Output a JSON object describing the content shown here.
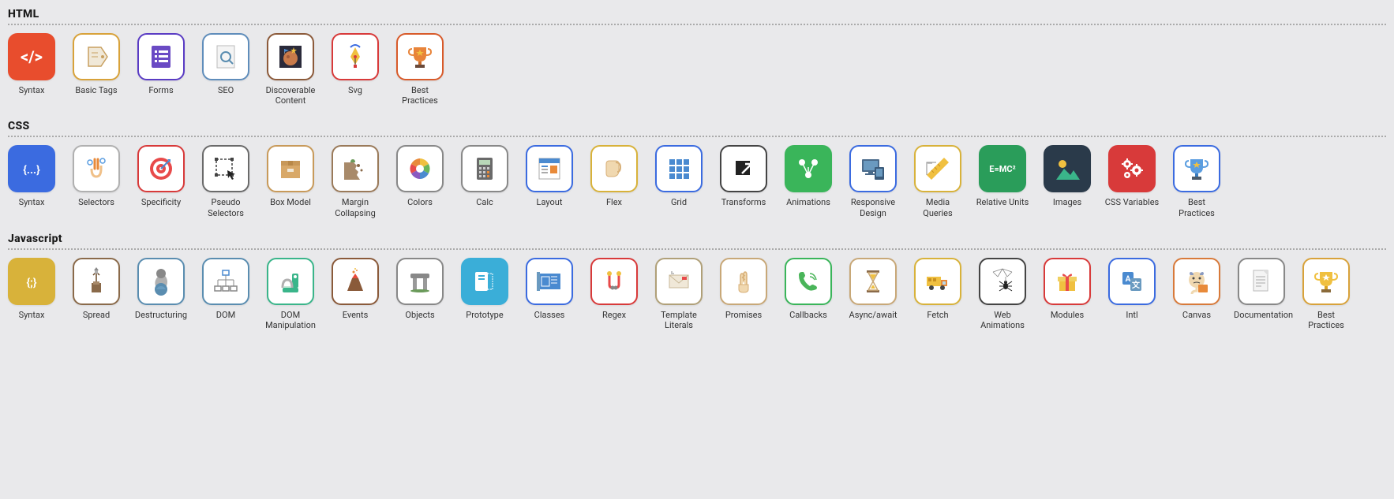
{
  "sections": [
    {
      "title": "HTML",
      "items": [
        {
          "label": "Syntax",
          "icon": "syntax-html",
          "bg": "#e84d2d",
          "border": "#e84d2d"
        },
        {
          "label": "Basic Tags",
          "icon": "tag",
          "bg": "#fff",
          "border": "#d8a23a"
        },
        {
          "label": "Forms",
          "icon": "form",
          "bg": "#fff",
          "border": "#5a3cc4"
        },
        {
          "label": "SEO",
          "icon": "seo",
          "bg": "#fff",
          "border": "#5f8dbb"
        },
        {
          "label": "Discoverable Content",
          "icon": "planet",
          "bg": "#fff",
          "border": "#8c5a3a"
        },
        {
          "label": "Svg",
          "icon": "pen",
          "bg": "#fff",
          "border": "#d83a3a"
        },
        {
          "label": "Best Practices",
          "icon": "trophy",
          "bg": "#fff",
          "border": "#d85a2a"
        }
      ]
    },
    {
      "title": "CSS",
      "items": [
        {
          "label": "Syntax",
          "icon": "syntax-css",
          "bg": "#3b6be0",
          "border": "#3b6be0"
        },
        {
          "label": "Selectors",
          "icon": "selectors",
          "bg": "#fff",
          "border": "#b0b0b0"
        },
        {
          "label": "Specificity",
          "icon": "target",
          "bg": "#fff",
          "border": "#d83a3a"
        },
        {
          "label": "Pseudo Selectors",
          "icon": "pseudo",
          "bg": "#fff",
          "border": "#6a6a6a"
        },
        {
          "label": "Box Model",
          "icon": "box",
          "bg": "#fff",
          "border": "#c89a5a"
        },
        {
          "label": "Margin Collapsing",
          "icon": "cliff",
          "bg": "#fff",
          "border": "#9a7a5a"
        },
        {
          "label": "Colors",
          "icon": "colors",
          "bg": "#fff",
          "border": "#888"
        },
        {
          "label": "Calc",
          "icon": "calc",
          "bg": "#fff",
          "border": "#888"
        },
        {
          "label": "Layout",
          "icon": "layout",
          "bg": "#fff",
          "border": "#3b6be0"
        },
        {
          "label": "Flex",
          "icon": "flex",
          "bg": "#fff",
          "border": "#d8b23a"
        },
        {
          "label": "Grid",
          "icon": "grid",
          "bg": "#fff",
          "border": "#3b6be0"
        },
        {
          "label": "Transforms",
          "icon": "transforms",
          "bg": "#fff",
          "border": "#444"
        },
        {
          "label": "Animations",
          "icon": "animations",
          "bg": "#3ab55a",
          "border": "#3ab55a"
        },
        {
          "label": "Responsive Design",
          "icon": "responsive",
          "bg": "#fff",
          "border": "#3b6be0"
        },
        {
          "label": "Media Queries",
          "icon": "ruler",
          "bg": "#fff",
          "border": "#d8b23a"
        },
        {
          "label": "Relative Units",
          "icon": "emc",
          "bg": "#2a9d5a",
          "border": "#2a9d5a"
        },
        {
          "label": "Images",
          "icon": "images",
          "bg": "#2a3a4a",
          "border": "#2a3a4a"
        },
        {
          "label": "CSS Variables",
          "icon": "gears",
          "bg": "#d83a3a",
          "border": "#d83a3a"
        },
        {
          "label": "Best Practices",
          "icon": "trophy-blue",
          "bg": "#fff",
          "border": "#3b6be0"
        }
      ]
    },
    {
      "title": "Javascript",
      "items": [
        {
          "label": "Syntax",
          "icon": "syntax-js",
          "bg": "#d8b23a",
          "border": "#d8b23a"
        },
        {
          "label": "Spread",
          "icon": "spread",
          "bg": "#fff",
          "border": "#8a6a4a"
        },
        {
          "label": "Destructuring",
          "icon": "destructuring",
          "bg": "#fff",
          "border": "#5a8db0"
        },
        {
          "label": "DOM",
          "icon": "dom",
          "bg": "#fff",
          "border": "#5a8db0"
        },
        {
          "label": "DOM Manipulation",
          "icon": "mixer",
          "bg": "#fff",
          "border": "#3ab58a"
        },
        {
          "label": "Events",
          "icon": "volcano",
          "bg": "#fff",
          "border": "#8a5a3a"
        },
        {
          "label": "Objects",
          "icon": "dolmen",
          "bg": "#fff",
          "border": "#888"
        },
        {
          "label": "Prototype",
          "icon": "prototype",
          "bg": "#3aaed8",
          "border": "#3aaed8"
        },
        {
          "label": "Classes",
          "icon": "blueprint",
          "bg": "#fff",
          "border": "#3b6be0"
        },
        {
          "label": "Regex",
          "icon": "regex",
          "bg": "#fff",
          "border": "#d83a3a"
        },
        {
          "label": "Template Literals",
          "icon": "envelope",
          "bg": "#fff",
          "border": "#b0a078"
        },
        {
          "label": "Promises",
          "icon": "fingers",
          "bg": "#fff",
          "border": "#c8a878"
        },
        {
          "label": "Callbacks",
          "icon": "phone",
          "bg": "#fff",
          "border": "#3ab55a"
        },
        {
          "label": "Async/await",
          "icon": "hourglass",
          "bg": "#fff",
          "border": "#c8a878"
        },
        {
          "label": "Fetch",
          "icon": "truck",
          "bg": "#fff",
          "border": "#d8b23a"
        },
        {
          "label": "Web Animations",
          "icon": "spider",
          "bg": "#fff",
          "border": "#444"
        },
        {
          "label": "Modules",
          "icon": "gift",
          "bg": "#fff",
          "border": "#d83a3a"
        },
        {
          "label": "Intl",
          "icon": "intl",
          "bg": "#fff",
          "border": "#3b6be0"
        },
        {
          "label": "Canvas",
          "icon": "canvas",
          "bg": "#fff",
          "border": "#d87a3a"
        },
        {
          "label": "Documentation",
          "icon": "doc",
          "bg": "#fff",
          "border": "#888"
        },
        {
          "label": "Best Practices",
          "icon": "trophy-gold",
          "bg": "#fff",
          "border": "#d8a23a"
        }
      ]
    }
  ]
}
